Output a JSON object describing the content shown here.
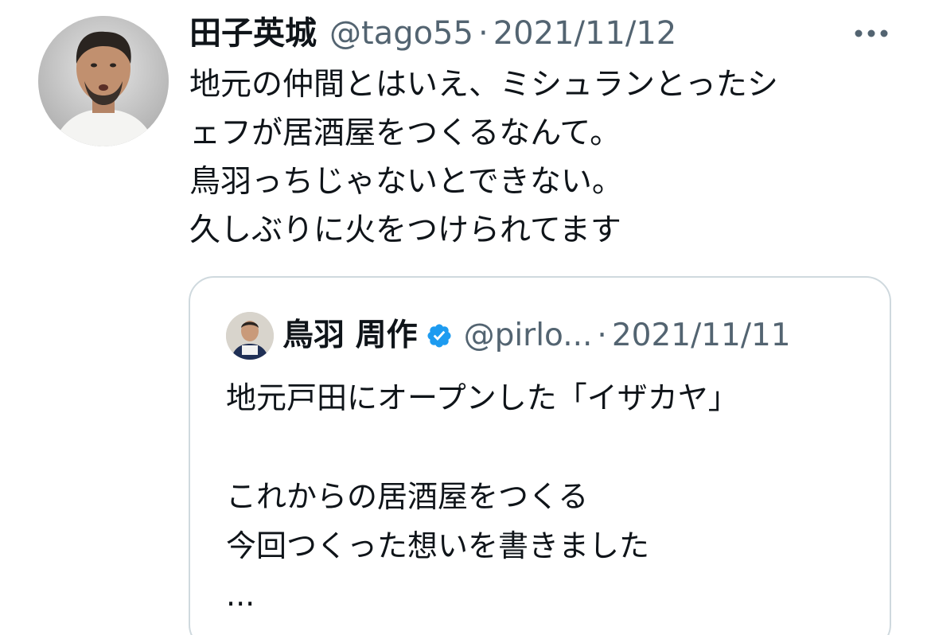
{
  "tweet": {
    "author_name": "田子英城",
    "author_handle": "@tago55",
    "separator": "·",
    "date": "2021/11/12",
    "text_lines": [
      "地元の仲間とはいえ、ミシュランとったシ",
      "ェフが居酒屋をつくるなんて。",
      "鳥羽っちじゃないとできない。",
      "久しぶりに火をつけられてます"
    ]
  },
  "quote": {
    "author_name": "鳥羽 周作",
    "verified_icon": "verified-badge-icon",
    "author_handle": "@pirlo...",
    "separator": "·",
    "date": "2021/11/11",
    "text_lines": [
      "地元戸田にオープンした「イザカヤ」",
      "",
      "これからの居酒屋をつくる",
      "今回つくった想いを書きました",
      "..."
    ]
  },
  "icons": {
    "more": "more-options-icon"
  },
  "colors": {
    "text_primary": "#0f1419",
    "text_secondary": "#536471",
    "border": "#cfd9de",
    "verified_blue": "#1d9bf0"
  }
}
